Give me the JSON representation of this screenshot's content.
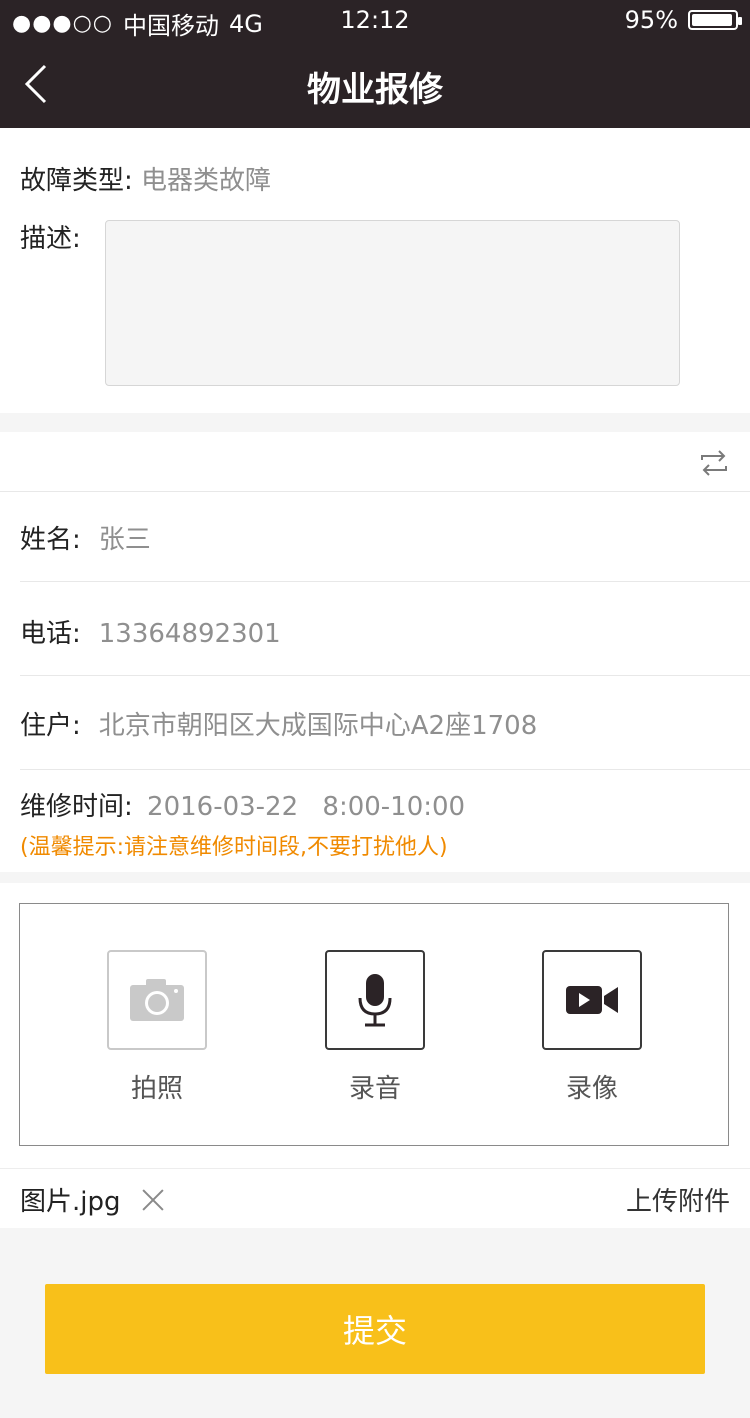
{
  "status_bar": {
    "signal_dots": "●●●○○",
    "carrier": "中国移动",
    "network": "4G",
    "time": "12:12",
    "battery": "95%",
    "battery_level": 0.95
  },
  "nav": {
    "back_icon": "chevron-left-icon",
    "title": "物业报修"
  },
  "fault": {
    "label": "故障类型:",
    "value": "电器类故障"
  },
  "description": {
    "label": "描述:",
    "value": ""
  },
  "contact": {
    "switch_icon": "switch-arrows-icon",
    "name_label": "姓名:",
    "name_value": "张三",
    "phone_label": "电话:",
    "phone_value": "13364892301",
    "address_label": "住户:",
    "address_value": "北京市朝阳区大成国际中心A2座1708",
    "time_label": "维修时间:",
    "time_date": "2016-03-22",
    "time_range": "8:00-10:00",
    "tip": "(温馨提示:请注意维修时间段,不要打扰他人)"
  },
  "media": {
    "photo_label": "拍照",
    "photo_icon": "camera-icon",
    "audio_label": "录音",
    "audio_icon": "microphone-icon",
    "video_label": "录像",
    "video_icon": "video-camera-icon"
  },
  "attachment": {
    "file_name": "图片.jpg",
    "remove_icon": "close-icon",
    "upload_label": "上传附件"
  },
  "submit_label": "提交",
  "colors": {
    "nav_bg": "#2b2326",
    "accent": "#f8c01a",
    "tip": "#f08a00"
  }
}
